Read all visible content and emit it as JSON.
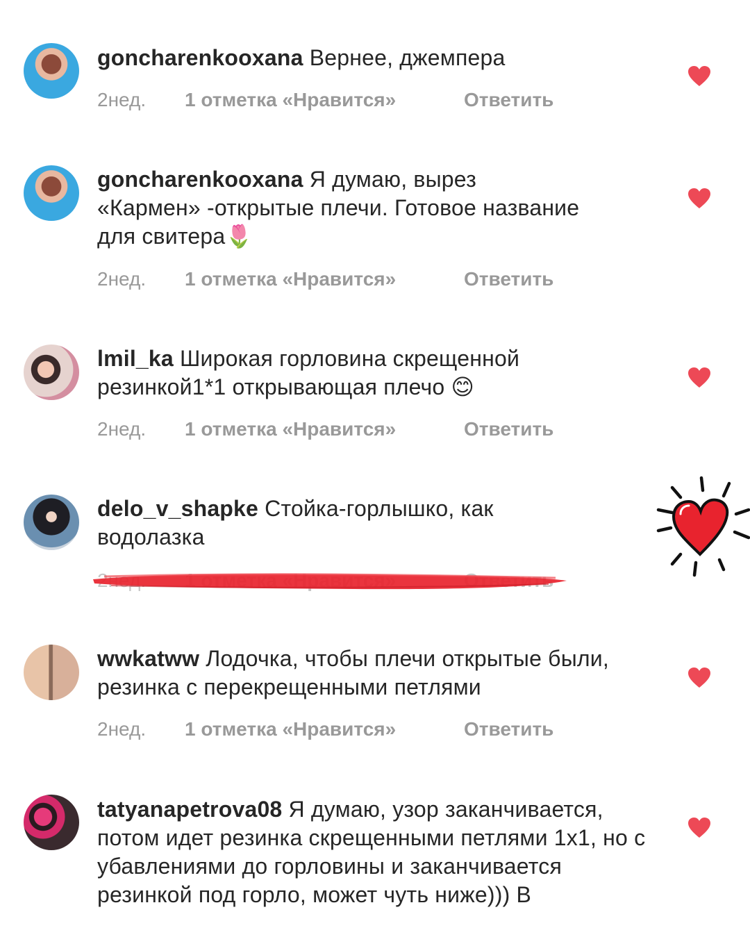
{
  "comments": [
    {
      "username": "goncharenkooxana",
      "text": " Вернее, джемпера",
      "time": "2нед.",
      "likes": "1 отметка «Нравится»",
      "reply": "Ответить"
    },
    {
      "username": "goncharenkooxana",
      "text": " Я думаю, вырез «Кармен» -открытые плечи. Готовое название для свитера",
      "emoji": "🌷",
      "time": "2нед.",
      "likes": "1 отметка «Нравится»",
      "reply": "Ответить"
    },
    {
      "username": "lmil_ka",
      "text": " Широкая горловина скрещенной резинкой1*1 открывающая плечо",
      "emoji": "😊",
      "time": "2нед.",
      "likes": "1 отметка «Нравится»",
      "reply": "Ответить"
    },
    {
      "username": "delo_v_shapke",
      "text": " Стойка-горлышко, как водолазка",
      "time": "2нед.",
      "likes": "1 отметка «Нравится»",
      "reply": "Ответить"
    },
    {
      "username": "wwkatww",
      "text": " Лодочка, чтобы плечи открытые были, резинка с перекрещенными петлями",
      "time": "2нед.",
      "likes": "1 отметка «Нравится»",
      "reply": "Ответить"
    },
    {
      "username": "tatyanapetrova08",
      "text": " Я думаю, узор заканчивается, потом идет резинка скрещенными петлями 1х1, но с убавлениями до горловины и заканчивается резинкой под горло, может чуть ниже))) В"
    }
  ],
  "colors": {
    "heart": "#ed4956",
    "meta": "#999999",
    "text": "#262626",
    "strike": "#e8232e"
  }
}
